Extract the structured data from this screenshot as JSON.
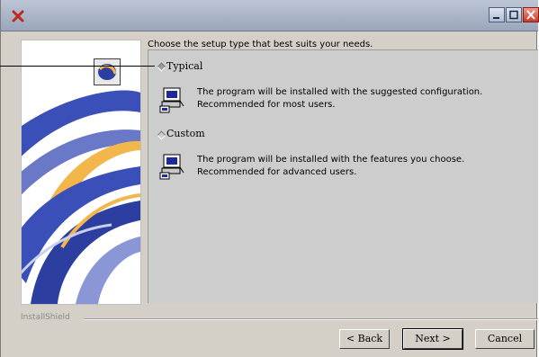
{
  "window": {
    "icons": {
      "app": "red-x-icon",
      "minimize": "minimize-icon",
      "maximize": "maximize-icon",
      "close": "close-icon"
    }
  },
  "setup": {
    "prompt": "Choose the setup type that best suits your needs.",
    "options": [
      {
        "label": "Typical",
        "selected": true,
        "description": [
          "The program will be installed with the suggested configuration.",
          "Recommended for most users."
        ],
        "icon": "computer-installer-icon"
      },
      {
        "label": "Custom",
        "selected": false,
        "description": [
          "The program will be installed with the features you choose.",
          "Recommended for advanced users."
        ],
        "icon": "computer-installer-icon"
      }
    ]
  },
  "footer": {
    "brand": "InstallShield",
    "buttons": {
      "back": "< Back",
      "next": "Next >",
      "cancel": "Cancel"
    }
  },
  "colors": {
    "titlebar": "#aeb8cb",
    "dialog": "#d4d0c8",
    "content": "#cdcdcd",
    "swoosh_blue": "#3a4fb8",
    "swoosh_orange": "#f2b64a"
  }
}
